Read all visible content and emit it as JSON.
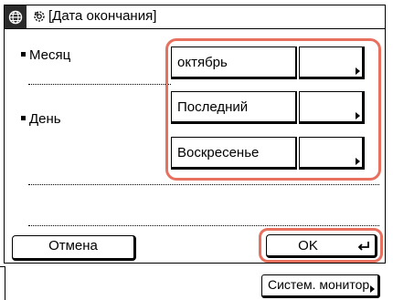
{
  "title": "[Дата окончания]",
  "rows": {
    "month": {
      "label": "Месяц",
      "value": "октябрь"
    },
    "day": {
      "label": "День",
      "value": "Последний",
      "weekday": "Воскресенье"
    }
  },
  "buttons": {
    "cancel": "Отмена",
    "ok": "OK",
    "system_monitor": "Систем. монитор"
  },
  "icons": {
    "title_left": "globe-icon",
    "title_settings": "settings-icon",
    "ok_enter": "enter-return-icon",
    "dropdown": "triangle-right-icon"
  },
  "colors": {
    "highlight": "#e8705e",
    "titlebar_icon_bg": "#2b2b2b"
  }
}
